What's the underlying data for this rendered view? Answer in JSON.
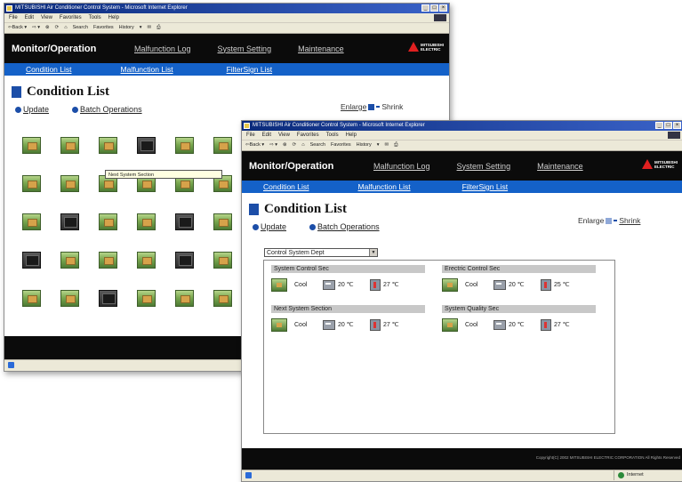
{
  "back_window": {
    "title": "MITSUBISHI Air Conditioner Control System - Microsoft Internet Explorer",
    "menu": [
      "File",
      "Edit",
      "View",
      "Favorites",
      "Tools",
      "Help"
    ],
    "toolbar": [
      "⇦Back ▾",
      "⇨ ▾",
      "⊗",
      "⟳",
      "⌂",
      "Search",
      "Favorites",
      "History",
      "▾",
      "✉",
      "⎙"
    ],
    "header": {
      "brand": "Monitor/Operation",
      "links": [
        "Malfunction Log",
        "System Setting",
        "Maintenance"
      ]
    },
    "subnav": [
      "Condition List",
      "Malfunction List",
      "FilterSign List"
    ],
    "page_title": "Condition List",
    "enlarge": "Enlarge",
    "shrink": "Shrink",
    "actions": {
      "update": "Update",
      "batch": "Batch Operations"
    },
    "tooltip": "Next System Section",
    "unit_types": [
      [
        "green",
        "green",
        "green",
        "dark",
        "green",
        "green"
      ],
      [
        "green",
        "green",
        "green",
        "green",
        "green",
        "green"
      ],
      [
        "green",
        "dark",
        "green",
        "green",
        "dark",
        "green"
      ],
      [
        "dark",
        "green",
        "green",
        "green",
        "dark",
        "green"
      ],
      [
        "green",
        "green",
        "dark",
        "green",
        "green",
        "green"
      ]
    ]
  },
  "front_window": {
    "title": "MITSUBISHI Air Conditioner Control System - Microsoft Internet Explorer",
    "menu": [
      "File",
      "Edit",
      "View",
      "Favorites",
      "Tools",
      "Help"
    ],
    "toolbar": [
      "⇦Back ▾",
      "⇨ ▾",
      "⊗",
      "⟳",
      "⌂",
      "Search",
      "Favorites",
      "History",
      "▾",
      "✉",
      "⎙"
    ],
    "header": {
      "brand": "Monitor/Operation",
      "links": [
        "Malfunction Log",
        "System Setting",
        "Maintenance"
      ]
    },
    "subnav": [
      "Condition List",
      "Malfunction List",
      "FilterSign List"
    ],
    "page_title": "Condition List",
    "enlarge": "Enlarge",
    "shrink": "Shrink",
    "actions": {
      "update": "Update",
      "batch": "Batch Operations"
    },
    "select_value": "Control System Dept",
    "groups": [
      {
        "name": "System Control Sec",
        "mode": "Cool",
        "room_temp": "20 ℃",
        "set_temp": "27 ℃"
      },
      {
        "name": "Erectric Control Sec",
        "mode": "Cool",
        "room_temp": "20 ℃",
        "set_temp": "25 ℃"
      },
      {
        "name": "Next System Section",
        "mode": "Cool",
        "room_temp": "20 ℃",
        "set_temp": "27 ℃"
      },
      {
        "name": "System Quality Sec",
        "mode": "Cool",
        "room_temp": "20 ℃",
        "set_temp": "27 ℃"
      }
    ],
    "copyright": "Copyright(C) 2002 MITSUBISHI ELECTRIC CORPORATION All Rights Reserved",
    "status_zone": "Internet"
  },
  "logo_text": [
    "MITSUBISHI",
    "ELECTRIC"
  ],
  "colors": {
    "nav_blue": "#1461c8",
    "header_black": "#0b0b0b",
    "accent_blue": "#1c4ea8",
    "logo_red": "#e02020"
  }
}
